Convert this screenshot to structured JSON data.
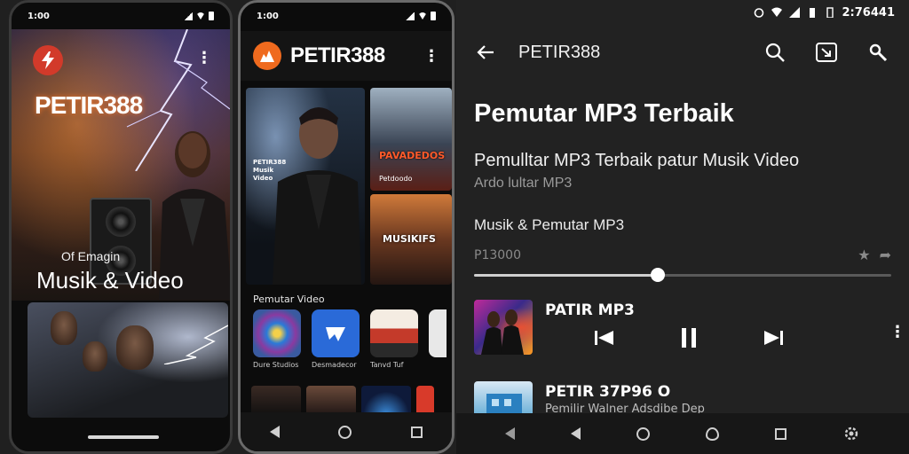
{
  "phone1": {
    "status_time": "1:00",
    "brand_text": "PETIR388",
    "poster_small_text": "PETIR388",
    "subtitle": "Of Emagin",
    "title": "Musik & Video"
  },
  "phone2": {
    "status_time": "1:00",
    "brand_text": "PETIR388",
    "feature_caption": "PETIR388 Musik Video",
    "card1_title": "PAVADEDOS",
    "card1_sub": "Petdoodo",
    "card2_title": "MUSIKIFS",
    "section_label": "Pemutar Video",
    "apps": [
      {
        "label": "Dure Studios",
        "color": "#3a5aa0"
      },
      {
        "label": "Desmadecor",
        "color": "#2a6ad8"
      },
      {
        "label": "Tanvd Tuf",
        "color": "#f2e9df"
      }
    ]
  },
  "panel": {
    "system_time": "2:76441",
    "toolbar_title": "PETIR388",
    "heading": "Pemutar MP3 Terbaik",
    "subheading": "Pemulltar MP3 Terbaik patur Musik Video",
    "subheading2": "Ardo lultar MP3",
    "category": "Musik & Pemutar MP3",
    "count": "P13000",
    "progress": 0.44,
    "tracks": [
      {
        "name": "PATIR MP3"
      },
      {
        "name": "PETIR 37P96  O",
        "sub": "Pemilir Walner Adsdibe Dep"
      }
    ]
  },
  "icons": {
    "back": "arrow-left-icon",
    "search": "search-icon",
    "cast": "cast-icon",
    "tool": "wrench-icon",
    "prev": "skip-previous-icon",
    "pause": "pause-icon",
    "next": "skip-next-icon",
    "more": "more-vertical-icon",
    "star": "star-icon",
    "share": "share-icon"
  },
  "colors": {
    "accent_orange": "#ef6a1e",
    "accent_red": "#d23a2a",
    "panel_bg": "#222222"
  }
}
